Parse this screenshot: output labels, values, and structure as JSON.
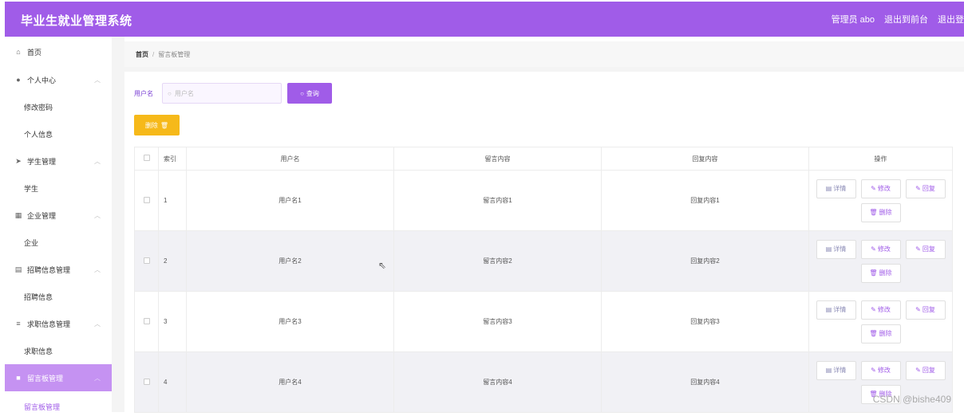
{
  "header": {
    "title": "毕业生就业管理系统",
    "user": "管理员 abo",
    "exit_front": "退出到前台",
    "logout": "退出登"
  },
  "sidebar": {
    "items": [
      {
        "label": "首页",
        "icon": "home-icon"
      },
      {
        "label": "个人中心",
        "icon": "user-icon",
        "children": [
          "修改密码",
          "个人信息"
        ]
      },
      {
        "label": "学生管理",
        "icon": "send-icon",
        "children": [
          "学生"
        ]
      },
      {
        "label": "企业管理",
        "icon": "grid-icon",
        "children": [
          "企业"
        ]
      },
      {
        "label": "招聘信息管理",
        "icon": "doc-icon",
        "children": [
          "招聘信息"
        ]
      },
      {
        "label": "求职信息管理",
        "icon": "list-icon",
        "children": [
          "求职信息"
        ]
      },
      {
        "label": "留言板管理",
        "icon": "message-icon",
        "children": [
          "留言板管理"
        ]
      }
    ]
  },
  "breadcrumb": {
    "home": "首页",
    "separator": "/",
    "current": "留言板管理"
  },
  "search": {
    "label": "用户名",
    "placeholder": "用户名",
    "button": "查询"
  },
  "toolbar": {
    "delete": "删除"
  },
  "table": {
    "headers": [
      "索引",
      "用户名",
      "留言内容",
      "回复内容",
      "操作"
    ],
    "rows": [
      {
        "index": "1",
        "username": "用户名1",
        "message": "留言内容1",
        "reply": "回复内容1"
      },
      {
        "index": "2",
        "username": "用户名2",
        "message": "留言内容2",
        "reply": "回复内容2"
      },
      {
        "index": "3",
        "username": "用户名3",
        "message": "留言内容3",
        "reply": "回复内容3"
      },
      {
        "index": "4",
        "username": "用户名4",
        "message": "留言内容4",
        "reply": "回复内容4"
      }
    ],
    "actions": {
      "detail": "详情",
      "edit": "修改",
      "reply": "回复",
      "delete": "删除"
    }
  },
  "watermark": "CSDN @bishe409",
  "colors": {
    "primary": "#a05ce8",
    "warning": "#f6b91a",
    "active_menu": "#c592f2"
  }
}
